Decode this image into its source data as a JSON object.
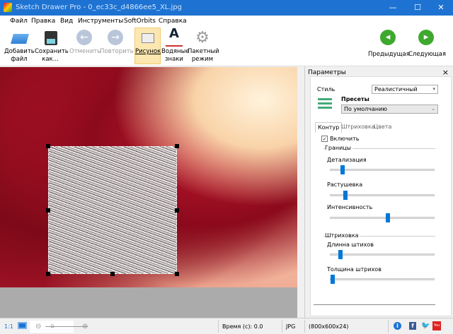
{
  "window": {
    "title": "Sketch Drawer Pro - 0_ec33c_d4866ee5_XL.jpg",
    "minimize": "—",
    "maximize": "☐",
    "close": "✕"
  },
  "menu": [
    "Файл",
    "Правка",
    "Вид",
    "Инструменты",
    "SoftOrbits",
    "Справка"
  ],
  "toolbar": {
    "add_file": "Добавить файл",
    "save_as": "Сохранить как...",
    "undo": "Отменить",
    "redo": "Повторить",
    "drawing": "Рисунок",
    "watermarks": "Водяные знаки",
    "batch": "Пакетный режим",
    "prev": "Предыдущая",
    "next": "Следующая"
  },
  "panel": {
    "title": "Параметры",
    "close": "×",
    "style_label": "Стиль",
    "style_value": "Реалистичный",
    "presets_label": "Пресеты",
    "presets_value": "По умолчанию",
    "tabs": [
      "Контур",
      "Штриховка",
      "Цвета"
    ],
    "active_tab": "Контур",
    "enable_label": "Включить",
    "enable_checked": true,
    "group_borders": "Границы",
    "group_hatch": "Штриховка",
    "sliders": [
      {
        "label": "Детализация",
        "value": 0.1
      },
      {
        "label": "Растушевка",
        "value": 0.13
      },
      {
        "label": "Интенсивность",
        "value": 0.55
      },
      {
        "label": "Длинна штихов",
        "value": 0.08
      },
      {
        "label": "Толщина штрихов",
        "value": 0.0
      }
    ]
  },
  "status": {
    "zoom_1to1": "1:1",
    "time": "Время (с): 0.0",
    "format": "JPG",
    "dimensions": "(800x600x24)",
    "zoom_level": 0.5
  },
  "colors": {
    "accent": "#1e73d2",
    "slider": "#0078d7",
    "active_tool": "#fde7b0"
  }
}
